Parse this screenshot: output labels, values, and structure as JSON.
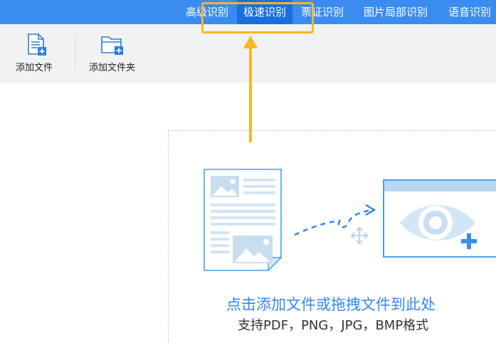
{
  "nav": {
    "tabs": [
      {
        "label": "高级识别",
        "active": false
      },
      {
        "label": "极速识别",
        "active": true
      },
      {
        "label": "票证识别",
        "active": false
      },
      {
        "label": "图片局部识别",
        "active": false
      },
      {
        "label": "语音识别",
        "active": false
      }
    ]
  },
  "toolbar": {
    "add_file_label": "添加文件",
    "add_folder_label": "添加文件夹"
  },
  "dropzone": {
    "title": "点击添加文件或拖拽文件到此处",
    "subtitle": "支持PDF，PNG，JPG，BMP格式"
  },
  "icons": {
    "add_file": "file-plus-icon",
    "add_folder": "folder-plus-icon",
    "document": "document-image-icon",
    "preview": "eye-window-icon",
    "move": "move-icon"
  },
  "colors": {
    "nav_bg": "#3b8cf0",
    "nav_active": "#1a6fdc",
    "accent": "#3388ee",
    "highlight": "#f8b623"
  }
}
